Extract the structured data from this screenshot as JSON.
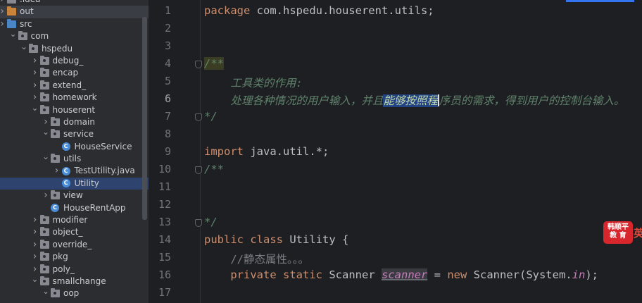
{
  "project_tree": {
    "items": [
      {
        "label": ".idea",
        "depth": 0,
        "type": "folder",
        "expanded": false,
        "color": "gray"
      },
      {
        "label": "out",
        "depth": 0,
        "type": "folder",
        "expanded": false,
        "color": "orange",
        "highlighted": true
      },
      {
        "label": "src",
        "depth": 0,
        "type": "folder",
        "expanded": false,
        "color": "blue"
      },
      {
        "label": "com",
        "depth": 1,
        "type": "package",
        "expanded": true
      },
      {
        "label": "hspedu",
        "depth": 2,
        "type": "package",
        "expanded": true
      },
      {
        "label": "debug_",
        "depth": 3,
        "type": "package",
        "expanded": false
      },
      {
        "label": "encap",
        "depth": 3,
        "type": "package",
        "expanded": false
      },
      {
        "label": "extend_",
        "depth": 3,
        "type": "package",
        "expanded": false
      },
      {
        "label": "homework",
        "depth": 3,
        "type": "package",
        "expanded": false
      },
      {
        "label": "houserent",
        "depth": 3,
        "type": "package",
        "expanded": true
      },
      {
        "label": "domain",
        "depth": 4,
        "type": "package",
        "expanded": false
      },
      {
        "label": "service",
        "depth": 4,
        "type": "package",
        "expanded": true
      },
      {
        "label": "HouseService",
        "depth": 5,
        "type": "class"
      },
      {
        "label": "utils",
        "depth": 4,
        "type": "package",
        "expanded": true
      },
      {
        "label": "TestUtility.java",
        "depth": 5,
        "type": "class",
        "expanded": false
      },
      {
        "label": "Utility",
        "depth": 5,
        "type": "class",
        "selected": true
      },
      {
        "label": "view",
        "depth": 4,
        "type": "package",
        "expanded": false
      },
      {
        "label": "HouseRentApp",
        "depth": 4,
        "type": "class"
      },
      {
        "label": "modifier",
        "depth": 3,
        "type": "package",
        "expanded": false
      },
      {
        "label": "object_",
        "depth": 3,
        "type": "package",
        "expanded": false
      },
      {
        "label": "override_",
        "depth": 3,
        "type": "package",
        "expanded": false
      },
      {
        "label": "pkg",
        "depth": 3,
        "type": "package",
        "expanded": false
      },
      {
        "label": "poly_",
        "depth": 3,
        "type": "package",
        "expanded": false
      },
      {
        "label": "smallchange",
        "depth": 3,
        "type": "package",
        "expanded": true
      },
      {
        "label": "oop",
        "depth": 4,
        "type": "package",
        "expanded": true
      }
    ]
  },
  "editor": {
    "current_line": 6,
    "lines": [
      {
        "num": "1",
        "code": {
          "kw": "package",
          "rest": " com.hspedu.houserent.utils;"
        }
      },
      {
        "num": "2"
      },
      {
        "num": "3"
      },
      {
        "num": "4",
        "code": {
          "doc_open": "/**"
        }
      },
      {
        "num": "5",
        "code": {
          "indent": "    ",
          "comment": "工具类的作用:"
        }
      },
      {
        "num": "6",
        "code": {
          "indent": "    ",
          "before": "处理各种情况的用户输入，并且",
          "selected": "能够按照程",
          "after": "序员的需求，得到用户的控制台输入。"
        }
      },
      {
        "num": "7",
        "code": {
          "doc_close": "*/"
        }
      },
      {
        "num": "8"
      },
      {
        "num": "9",
        "code": {
          "kw": "import",
          "rest": " java.util.*;"
        }
      },
      {
        "num": "10",
        "code": {
          "doc_open": "/**"
        }
      },
      {
        "num": "11"
      },
      {
        "num": "12"
      },
      {
        "num": "13",
        "code": {
          "doc_close": "*/"
        }
      },
      {
        "num": "14",
        "code": {
          "kw1": "public",
          "kw2": "class",
          "name": " Utility {"
        }
      },
      {
        "num": "15",
        "code": {
          "indent": "    ",
          "line_comment": "//静态属性。。。"
        }
      },
      {
        "num": "16",
        "code": {
          "indent": "    ",
          "kw1": "private",
          "kw2": "static",
          "type": " Scanner ",
          "field": "scanner",
          "eq": " = ",
          "kw3": "new",
          "ctor": " Scanner(System.",
          "static_field": "in",
          "end": ");"
        }
      },
      {
        "num": "17"
      }
    ]
  },
  "logo": {
    "line1": "韩顺平",
    "line2": "教 育",
    "tail": "英"
  },
  "colors": {
    "background": "#1e1f22",
    "sidebar": "#2b2d30",
    "keyword": "#cf8e6d",
    "doc_comment": "#5f826b",
    "selection": "#214283",
    "field": "#c77dbb",
    "accent": "#3574f0"
  }
}
